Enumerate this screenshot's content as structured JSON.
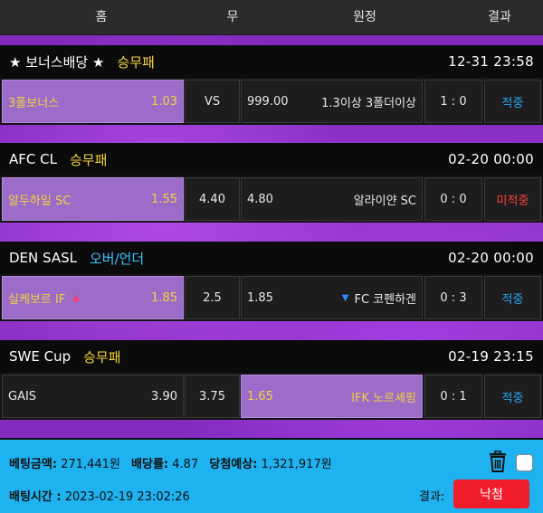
{
  "header": {
    "home": "홈",
    "draw": "무",
    "away": "원정",
    "result": "결과"
  },
  "games": [
    {
      "league": "★ 보너스배당 ★",
      "market": "승무패",
      "datetime": "12-31 23:58",
      "home_name": "3폴보너스",
      "home_odds": "1.03",
      "draw": "VS",
      "away_odds": "999.00",
      "away_name": "1.3이상 3폴더이상",
      "score": "1 : 0",
      "result": "적중",
      "selected": "home"
    },
    {
      "league": "AFC CL",
      "market": "승무패",
      "datetime": "02-20 00:00",
      "home_name": "알두하일 SC",
      "home_odds": "1.55",
      "draw": "4.40",
      "away_odds": "4.80",
      "away_name": "알라이얀 SC",
      "score": "0 : 0",
      "result": "미적중",
      "selected": "home"
    },
    {
      "league": "DEN SASL",
      "market": "오버/언더",
      "datetime": "02-20 00:00",
      "home_name": "실케보르 IF",
      "home_odds": "1.85",
      "draw": "2.5",
      "away_odds": "1.85",
      "away_name": "FC 코펜하겐",
      "score": "0 : 3",
      "result": "적중",
      "selected": "home"
    },
    {
      "league": "SWE Cup",
      "market": "승무패",
      "datetime": "02-19 23:15",
      "home_name": "GAIS",
      "home_odds": "3.90",
      "draw": "3.75",
      "away_odds": "1.65",
      "away_name": "IFK 노르셰핑",
      "score": "0 : 1",
      "result": "적중",
      "selected": "away"
    }
  ],
  "footer": {
    "bet_amount_label": "베팅금액:",
    "bet_amount": "271,441원",
    "odds_label": "배당률:",
    "odds": "4.87",
    "expected_label": "당첨예상:",
    "expected": "1,321,917원",
    "bet_time_label": "배팅시간 :",
    "bet_time": "2023-02-19 23:02:26",
    "result_label": "결과:",
    "result_button": "낙첨"
  },
  "colors": {
    "accent_yellow": "#f2d23a",
    "win_blue": "#2aa6f0",
    "lose_red": "#ff4040",
    "selected_purple": "#9c6cc9",
    "footer_blue": "#1fb2f0",
    "result_button_red": "#f21d2c"
  },
  "icons": {
    "up_arrow": "up-triangle-icon",
    "down_arrow": "down-triangle-icon",
    "trash": "trash-icon",
    "checkbox": "checkbox"
  }
}
